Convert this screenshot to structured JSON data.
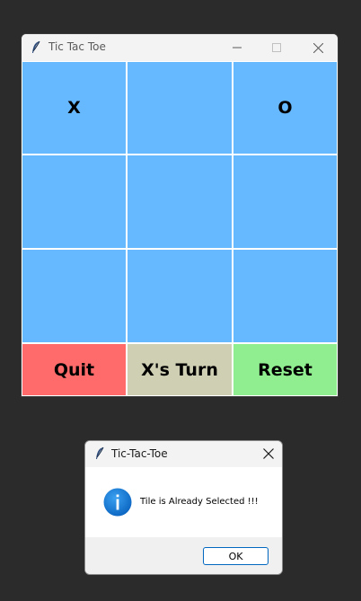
{
  "main_window": {
    "title": "Tic Tac Toe",
    "icon": "feather-icon",
    "controls": {
      "minimize_icon": "minimize-icon",
      "maximize_icon": "maximize-icon",
      "close_icon": "close-icon"
    }
  },
  "board": {
    "cell_color": "#66b8ff",
    "cells": [
      [
        "X",
        "",
        "O"
      ],
      [
        "",
        "",
        ""
      ],
      [
        "",
        "",
        ""
      ]
    ]
  },
  "controls": {
    "quit_label": "Quit",
    "quit_color": "#ff6b6b",
    "turn_label": "X's Turn",
    "turn_color": "#cfcfb4",
    "reset_label": "Reset",
    "reset_color": "#90ee90"
  },
  "dialog": {
    "title": "Tic-Tac-Toe",
    "icon": "info-icon",
    "message": "Tile is Already Selected !!!",
    "ok_label": "OK"
  }
}
